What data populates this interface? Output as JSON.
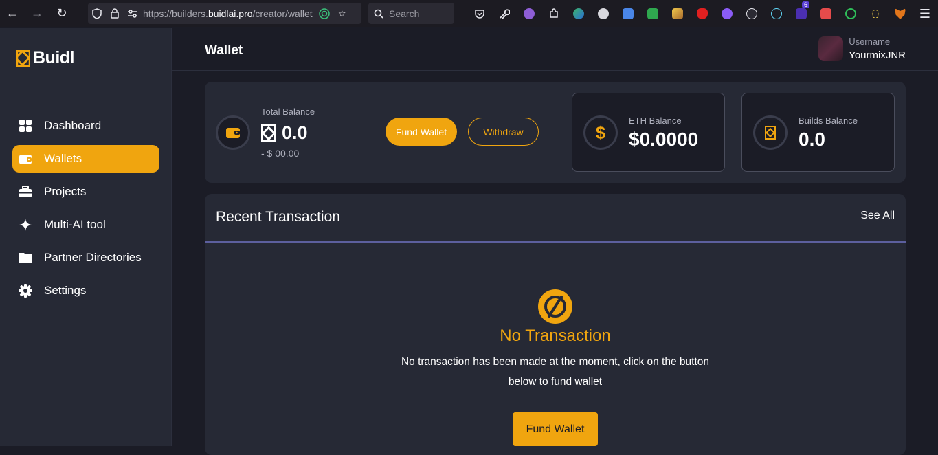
{
  "browser": {
    "url_prefix": "https://builders.",
    "url_domain": "buidlai.pro",
    "url_path": "/creator/wallet",
    "search_placeholder": "Search",
    "ext_badge": "6"
  },
  "sidebar": {
    "logo": "Buidl",
    "items": [
      {
        "label": "Dashboard",
        "icon": "grid-icon"
      },
      {
        "label": "Wallets",
        "icon": "wallet-icon",
        "active": true
      },
      {
        "label": "Projects",
        "icon": "briefcase-icon"
      },
      {
        "label": "Multi-AI tool",
        "icon": "sparkle-icon"
      },
      {
        "label": "Partner Directories",
        "icon": "folder-icon"
      },
      {
        "label": "Settings",
        "icon": "gear-icon"
      }
    ]
  },
  "header": {
    "title": "Wallet",
    "user_label": "Username",
    "user_name": "YourmixJNR"
  },
  "balance": {
    "total_label": "Total Balance",
    "total_value": "0.0",
    "total_sub": "- $ 00.00",
    "fund_label": "Fund Wallet",
    "withdraw_label": "Withdraw",
    "eth_label": "ETH Balance",
    "eth_value": "$0.0000",
    "builds_label": "Builds Balance",
    "builds_value": "0.0"
  },
  "transactions": {
    "title": "Recent Transaction",
    "see_all": "See All",
    "empty_title": "No Transaction",
    "empty_desc": "No transaction has been made at the moment, click on the button below to fund wallet",
    "fund_label": "Fund Wallet"
  },
  "colors": {
    "accent": "#f0a50f",
    "background": "#1b1c26",
    "panel": "#262935"
  }
}
